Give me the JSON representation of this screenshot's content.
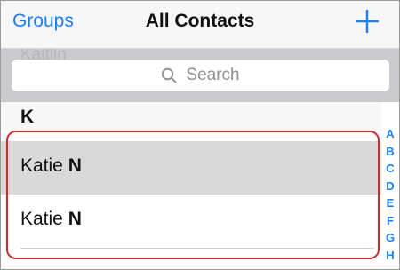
{
  "navbar": {
    "left_label": "Groups",
    "title": "All Contacts",
    "add_icon": "plus-icon"
  },
  "search": {
    "placeholder": "Search",
    "behind_text": "Kaitlin",
    "icon": "search-icon"
  },
  "section": {
    "header": "K"
  },
  "contacts": [
    {
      "first": "Katie",
      "last": "N",
      "selected": true
    },
    {
      "first": "Katie",
      "last": "N",
      "selected": false
    }
  ],
  "index_letters": [
    "A",
    "B",
    "C",
    "D",
    "E",
    "F",
    "G",
    "H"
  ],
  "colors": {
    "accent": "#1a7ef5",
    "highlight_border": "#d6262f",
    "search_bar_bg": "#c9c9ce",
    "selected_row_bg": "#d9d9d9"
  }
}
